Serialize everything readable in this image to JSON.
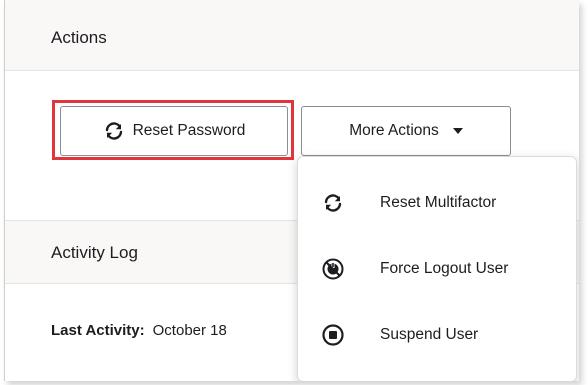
{
  "sections": {
    "actions_title": "Actions",
    "activity_title": "Activity Log"
  },
  "buttons": {
    "reset_password": "Reset Password",
    "more_actions": "More Actions"
  },
  "activity": {
    "last_activity_label": "Last Activity:",
    "last_activity_value": "October 18"
  },
  "dropdown": {
    "items": [
      {
        "label": "Reset Multifactor",
        "icon": "refresh-icon"
      },
      {
        "label": "Force Logout User",
        "icon": "power-off-icon"
      },
      {
        "label": "Suspend User",
        "icon": "stop-circle-icon"
      }
    ]
  },
  "colors": {
    "highlight": "#e2353b",
    "text": "#1d1d21",
    "header_bg": "#f9f8f6"
  }
}
